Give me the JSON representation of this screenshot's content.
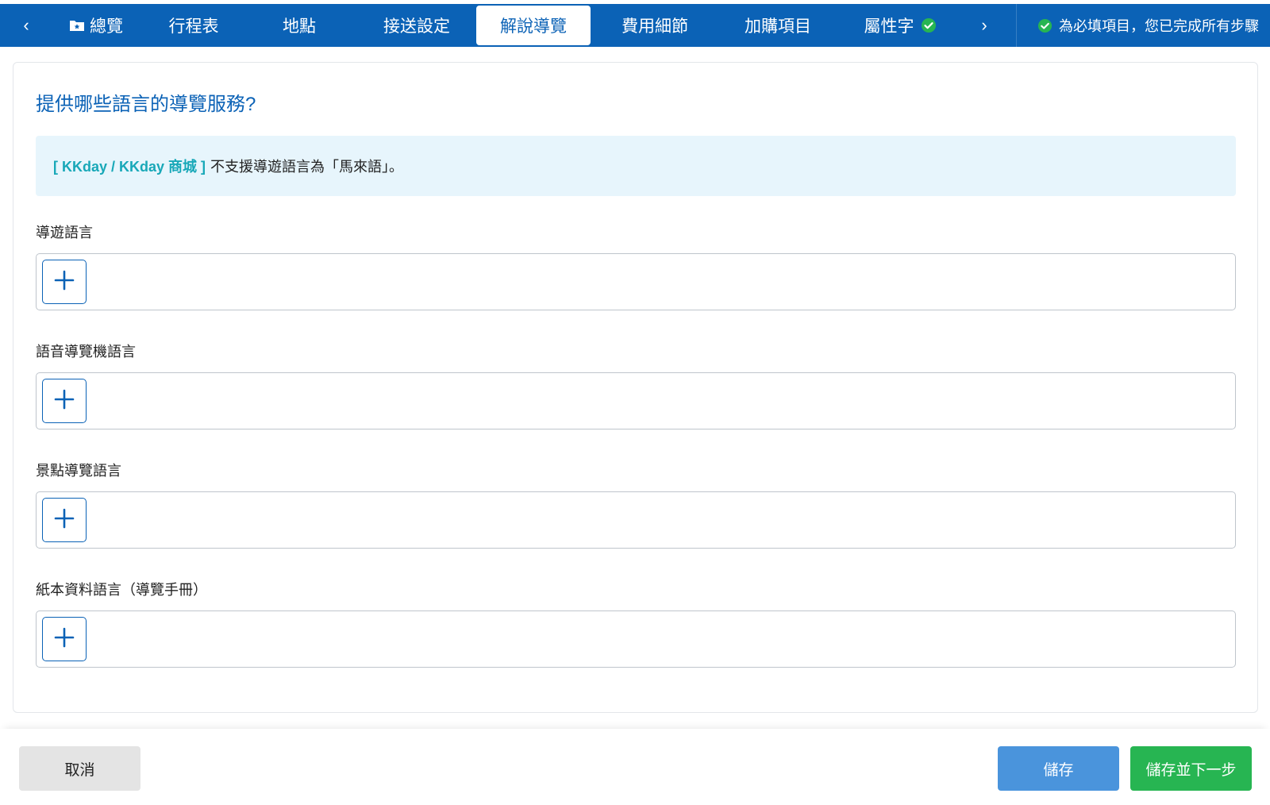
{
  "nav": {
    "prev_glyph": "‹",
    "next_glyph": "›",
    "tabs": [
      {
        "label": "總覽",
        "icon": "folder-star-icon"
      },
      {
        "label": "行程表"
      },
      {
        "label": "地點"
      },
      {
        "label": "接送設定"
      },
      {
        "label": "解說導覽",
        "active": true
      },
      {
        "label": "費用細節"
      },
      {
        "label": "加購項目"
      },
      {
        "label": "屬性字",
        "status_icon": "check-circle-icon"
      }
    ],
    "status_text": "為必填項目，您已完成所有步驟"
  },
  "page": {
    "title": "提供哪些語言的導覽服務?",
    "notice": {
      "brand": "[ KKday / KKday 商城 ]",
      "text": "不支援導遊語言為「馬來語」。"
    },
    "fields": [
      {
        "label": "導遊語言"
      },
      {
        "label": "語音導覽機語言"
      },
      {
        "label": "景點導覽語言"
      },
      {
        "label": "紙本資料語言（導覽手冊）"
      }
    ]
  },
  "footer": {
    "cancel_label": "取消",
    "save_label": "儲存",
    "save_next_label": "儲存並下一步"
  },
  "colors": {
    "nav_bg": "#0b62b6",
    "accent": "#0b62b6",
    "notice_bg": "#e7f5fc",
    "brand_teal": "#18a8b8",
    "success_green": "#27b552",
    "save_blue": "#4a94dc"
  }
}
